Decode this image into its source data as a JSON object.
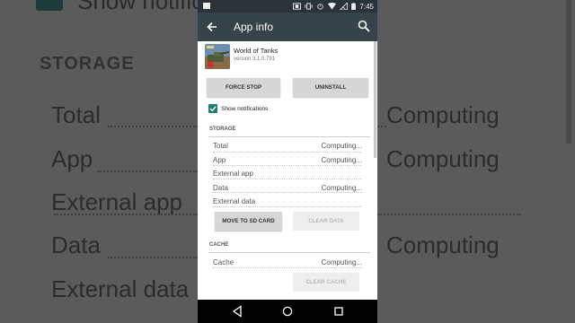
{
  "status_bar": {
    "time": "7:45"
  },
  "app_bar": {
    "title": "App info"
  },
  "app": {
    "name": "World of Tanks",
    "version": "version 3.1.0.791"
  },
  "buttons": {
    "force_stop": "FORCE STOP",
    "uninstall": "UNINSTALL"
  },
  "notifications": {
    "label": "Show notifications",
    "checked": true
  },
  "storage": {
    "header": "STORAGE",
    "rows": [
      {
        "label": "Total",
        "value": "Computing..."
      },
      {
        "label": "App",
        "value": "Computing..."
      },
      {
        "label": "External app",
        "value": ""
      },
      {
        "label": "Data",
        "value": "Computing..."
      },
      {
        "label": "External data",
        "value": ""
      }
    ],
    "move_to_sd": "MOVE TO SD CARD",
    "clear_data": "CLEAR DATA"
  },
  "cache": {
    "header": "CACHE",
    "rows": [
      {
        "label": "Cache",
        "value": "Computing..."
      }
    ],
    "clear_cache": "CLEAR CACHE"
  },
  "background": {
    "partial_notification": "Show notificat",
    "storage_header": "STORAGE",
    "labels": [
      "Total",
      "App",
      "External app",
      "Data",
      "External data"
    ],
    "values": [
      "Computing",
      "Computing",
      "Computing"
    ]
  },
  "colors": {
    "app_bar": "#37434a",
    "status_bar": "#2b3339",
    "checkbox_accent": "#1f7f74",
    "button_bg": "#d6d6d6"
  }
}
